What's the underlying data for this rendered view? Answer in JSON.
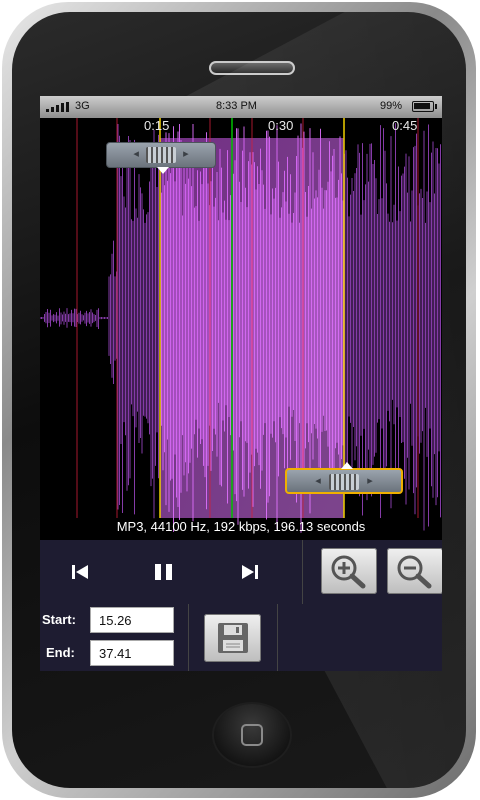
{
  "status_bar": {
    "carrier": "3G",
    "time": "8:33 PM",
    "battery": "99%"
  },
  "waveform": {
    "time_marks": [
      "0:15",
      "0:30",
      "0:45"
    ],
    "file_info": "MP3, 44100 Hz, 192 kbps, 196.13 seconds"
  },
  "playback": {
    "prev_icon": "skip-previous-icon",
    "pause_icon": "pause-icon",
    "next_icon": "skip-next-icon",
    "zoom_in_icon": "zoom-in-icon",
    "zoom_out_icon": "zoom-out-icon"
  },
  "selection": {
    "start_label": "Start:",
    "start_value": "15.26",
    "end_label": "End:",
    "end_value": "37.41",
    "save_icon": "save-icon"
  },
  "colors": {
    "waveform": "#b24fe0",
    "selected_waveform": "#e070ff",
    "start_marker": "#f0d000",
    "end_marker": "#f0d000",
    "playhead": "#00c000",
    "panel_background": "#1e1c31"
  }
}
